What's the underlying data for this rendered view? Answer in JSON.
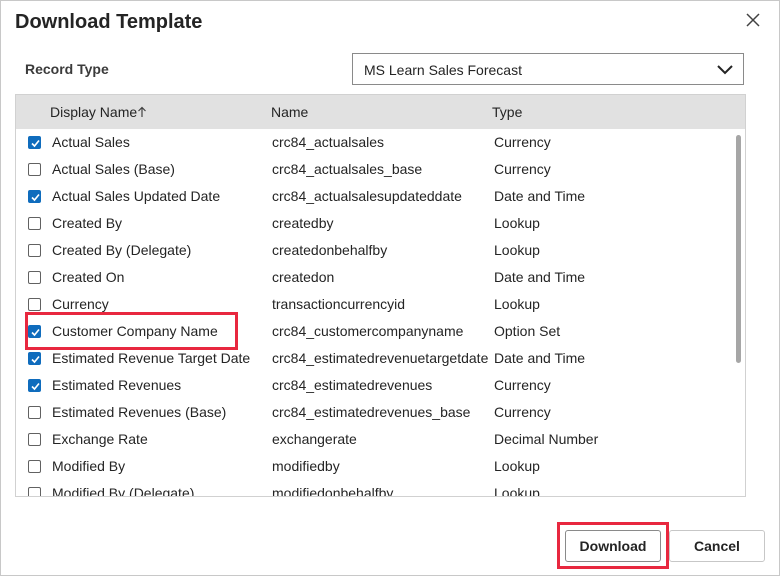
{
  "dialog": {
    "title": "Download Template",
    "close_icon": "close-icon"
  },
  "record_type": {
    "label": "Record Type",
    "selected": "MS Learn Sales Forecast"
  },
  "table": {
    "columns": [
      "Display Name",
      "Name",
      "Type"
    ],
    "sort_icon": "arrow-up-icon",
    "rows": [
      {
        "checked": true,
        "display": "Actual Sales",
        "name": "crc84_actualsales",
        "type": "Currency"
      },
      {
        "checked": false,
        "display": "Actual Sales (Base)",
        "name": "crc84_actualsales_base",
        "type": "Currency"
      },
      {
        "checked": true,
        "display": "Actual Sales Updated Date",
        "name": "crc84_actualsalesupdateddate",
        "type": "Date and Time"
      },
      {
        "checked": false,
        "display": "Created By",
        "name": "createdby",
        "type": "Lookup"
      },
      {
        "checked": false,
        "display": "Created By (Delegate)",
        "name": "createdonbehalfby",
        "type": "Lookup"
      },
      {
        "checked": false,
        "display": "Created On",
        "name": "createdon",
        "type": "Date and Time"
      },
      {
        "checked": false,
        "display": "Currency",
        "name": "transactioncurrencyid",
        "type": "Lookup"
      },
      {
        "checked": true,
        "display": "Customer Company Name",
        "name": "crc84_customercompanyname",
        "type": "Option Set"
      },
      {
        "checked": true,
        "display": "Estimated Revenue Target Date",
        "name": "crc84_estimatedrevenuetargetdate",
        "type": "Date and Time"
      },
      {
        "checked": true,
        "display": "Estimated Revenues",
        "name": "crc84_estimatedrevenues",
        "type": "Currency"
      },
      {
        "checked": false,
        "display": "Estimated Revenues (Base)",
        "name": "crc84_estimatedrevenues_base",
        "type": "Currency"
      },
      {
        "checked": false,
        "display": "Exchange Rate",
        "name": "exchangerate",
        "type": "Decimal Number"
      },
      {
        "checked": false,
        "display": "Modified By",
        "name": "modifiedby",
        "type": "Lookup"
      },
      {
        "checked": false,
        "display": "Modified By (Delegate)",
        "name": "modifiedonbehalfby",
        "type": "Lookup"
      }
    ]
  },
  "footer": {
    "download_label": "Download",
    "cancel_label": "Cancel"
  },
  "colors": {
    "accent": "#0f6cbd",
    "highlight": "#e8283f",
    "header_bg": "#e1e1e1"
  }
}
